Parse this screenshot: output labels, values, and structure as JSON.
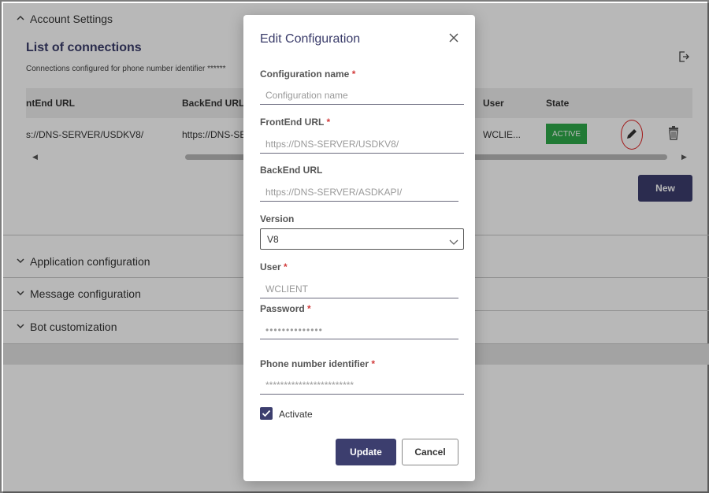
{
  "account_settings": {
    "header": "Account Settings",
    "title": "List of connections",
    "subtitle": "Connections configured for phone number identifier ******",
    "table": {
      "headers": {
        "frontend": "ntEnd URL",
        "backend": "BackEnd URL",
        "user": "User",
        "state": "State"
      },
      "row": {
        "frontend": "s://DNS-SERVER/USDKV8/",
        "backend": "https://DNS-SE",
        "user": "WCLIE...",
        "state": "ACTIVE"
      }
    },
    "new_label": "New"
  },
  "accordion": {
    "application": "Application configuration",
    "message": "Message configuration",
    "bot": "Bot customization"
  },
  "modal": {
    "title": "Edit Configuration",
    "config_name": {
      "label": "Configuration name",
      "placeholder": "Configuration name",
      "value": ""
    },
    "frontend_url": {
      "label": "FrontEnd URL",
      "value": "https://DNS-SERVER/USDKV8/"
    },
    "backend_url": {
      "label": "BackEnd URL",
      "value": "https://DNS-SERVER/ASDKAPI/"
    },
    "version": {
      "label": "Version",
      "value": "V8"
    },
    "user": {
      "label": "User",
      "value": "WCLIENT"
    },
    "password": {
      "label": "Password",
      "value": "••••••••••••••"
    },
    "phone_id": {
      "label": "Phone number identifier",
      "value": "************************"
    },
    "activate_label": "Activate",
    "update_label": "Update",
    "cancel_label": "Cancel",
    "required_mark": "*"
  },
  "colors": {
    "primary": "#3c3e6e",
    "active_badge": "#2eaa4a",
    "highlight_ring": "#e02020",
    "required": "#d23b3b"
  }
}
